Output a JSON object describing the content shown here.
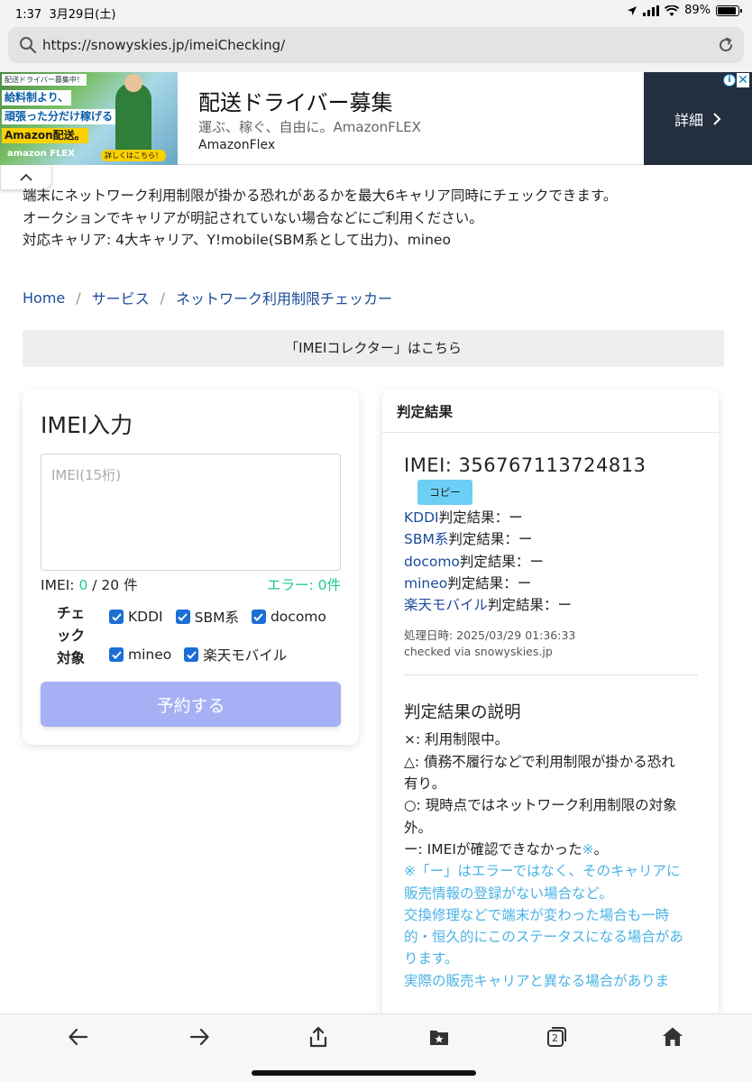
{
  "status_bar": {
    "time": "1:37",
    "date": "3月29日(土)",
    "battery": "89%",
    "battery_level": 0.89
  },
  "browser": {
    "url": "https://snowyskies.jp/imeiChecking/"
  },
  "ad": {
    "image_tag": "配送ドライバー募集中！",
    "image_lines": [
      "給料制より、",
      "頑張った分だけ稼げる",
      "Amazon配送。"
    ],
    "image_brand": "amazon FLEX",
    "image_button": "詳しくはこちら！",
    "title": "配送ドライバー募集",
    "subtitle": "運ぶ、稼ぐ、自由に。AmazonFLEX",
    "brand": "AmazonFlex",
    "cta": "詳細"
  },
  "intro_lines": [
    "端末にネットワーク利用制限が掛かる恐れがあるかを最大6キャリア同時にチェックできます。",
    "オークションでキャリアが明記されていない場合などにご利用ください。",
    "対応キャリア: 4大キャリア、Y!mobile(SBM系として出力)、mineo"
  ],
  "breadcrumb": {
    "home": "Home",
    "sep": "/",
    "services": "サービス",
    "current": "ネットワーク利用制限チェッカー"
  },
  "collector_link": "「IMEIコレクター」はこちら",
  "input_card": {
    "title": "IMEI入力",
    "placeholder": "IMEI(15桁)",
    "count_prefix": "IMEI: ",
    "count_value": "0",
    "count_suffix": " / 20 件",
    "error_text": "エラー: 0件",
    "check_label": "チェック対象",
    "checkboxes": [
      "KDDI",
      "SBM系",
      "docomo",
      "mineo",
      "楽天モバイル"
    ],
    "submit": "予約する"
  },
  "result_card": {
    "header": "判定結果",
    "imei": "IMEI: 356767113724813",
    "copy": "コピー",
    "results": [
      {
        "carrier": "KDDI",
        "label": "判定結果：ー"
      },
      {
        "carrier": "SBM系",
        "label": "判定結果：ー"
      },
      {
        "carrier": "docomo",
        "label": "判定結果：ー"
      },
      {
        "carrier": "mineo",
        "label": "判定結果：ー"
      },
      {
        "carrier": "楽天モバイル",
        "label": "判定結果：ー"
      }
    ],
    "processed_at": "処理日時: 2025/03/29 01:36:33",
    "checked_via": "checked via snowyskies.jp",
    "explain_title": "判定結果の説明",
    "explain": {
      "x": "×: 利用制限中。",
      "tri_1": "△: 債務不履行などで利用制限が掛かる恐れ",
      "tri_2": "有り。",
      "circle_1": "○: 現時点ではネットワーク利用制限の対象",
      "circle_2": "外。",
      "dash": "ー: IMEIが確認できなかった",
      "dash_mark": "※",
      "dash_end": "。",
      "note_1": "※「ー」はエラーではなく、そのキャリアに",
      "note_2": "販売情報の登録がない場合など。",
      "note_3": "交換修理などで端末が変わった場合も一時",
      "note_4": "的・恒久的にこのステータスになる場合があ",
      "note_5": "ります。",
      "note_6": "実際の販売キャリアと異なる場合がありま"
    }
  },
  "toolbar": {
    "tabs_count": "2"
  }
}
